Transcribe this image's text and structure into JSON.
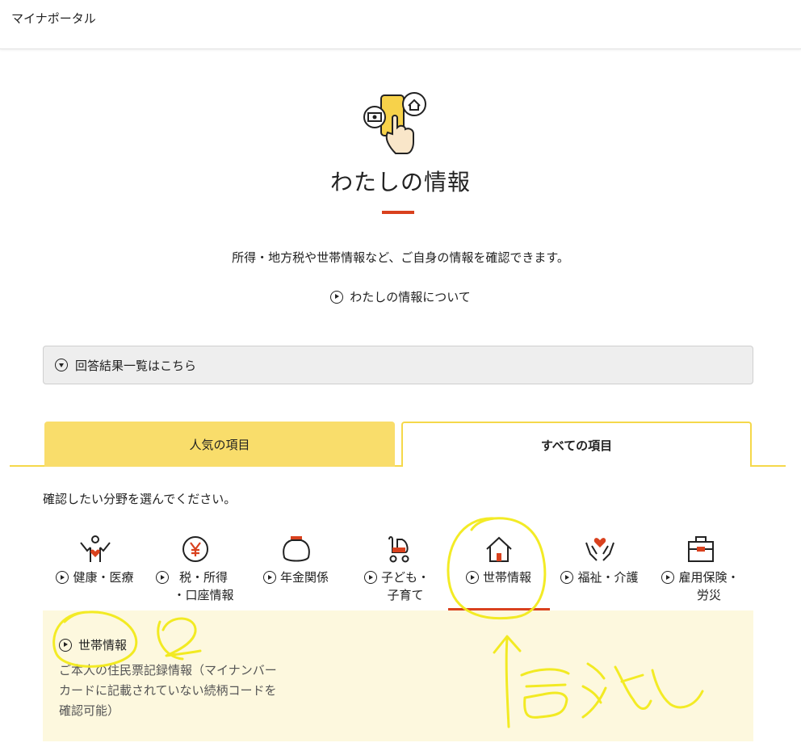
{
  "header": {
    "app_title": "マイナポータル"
  },
  "hero": {
    "icon": "smartphone-services-icon",
    "title": "わたしの情報",
    "description": "所得・地方税や世帯情報など、ご自身の情報を確認できます。",
    "about_link": "わたしの情報について"
  },
  "results": {
    "label": "回答結果一覧はこちら"
  },
  "tabs": [
    {
      "label": "人気の項目",
      "selected": false
    },
    {
      "label": "すべての項目",
      "selected": true
    }
  ],
  "prompt": "確認したい分野を選んでください。",
  "categories": [
    {
      "label": "健康・医療",
      "icon": "health-person-heart-icon"
    },
    {
      "label": "税・所得\n・口座情報",
      "icon": "yen-coin-icon"
    },
    {
      "label": "年金関係",
      "icon": "purse-icon"
    },
    {
      "label": "子ども・\n子育て",
      "icon": "stroller-icon"
    },
    {
      "label": "世帯情報",
      "icon": "house-icon",
      "active": true
    },
    {
      "label": "福祉・介護",
      "icon": "hands-heart-icon"
    },
    {
      "label": "雇用保険・\n労災",
      "icon": "briefcase-icon"
    }
  ],
  "detail": {
    "title": "世帯情報",
    "description": "ご本人の住民票記録情報（マイナンバーカードに記載されていない続柄コードを確認可能）"
  },
  "colors": {
    "accent_red": "#d9411e",
    "tab_yellow": "#f9dd6b",
    "panel_bg": "#fdf8de",
    "annotation_yellow": "#f2ea1a"
  }
}
